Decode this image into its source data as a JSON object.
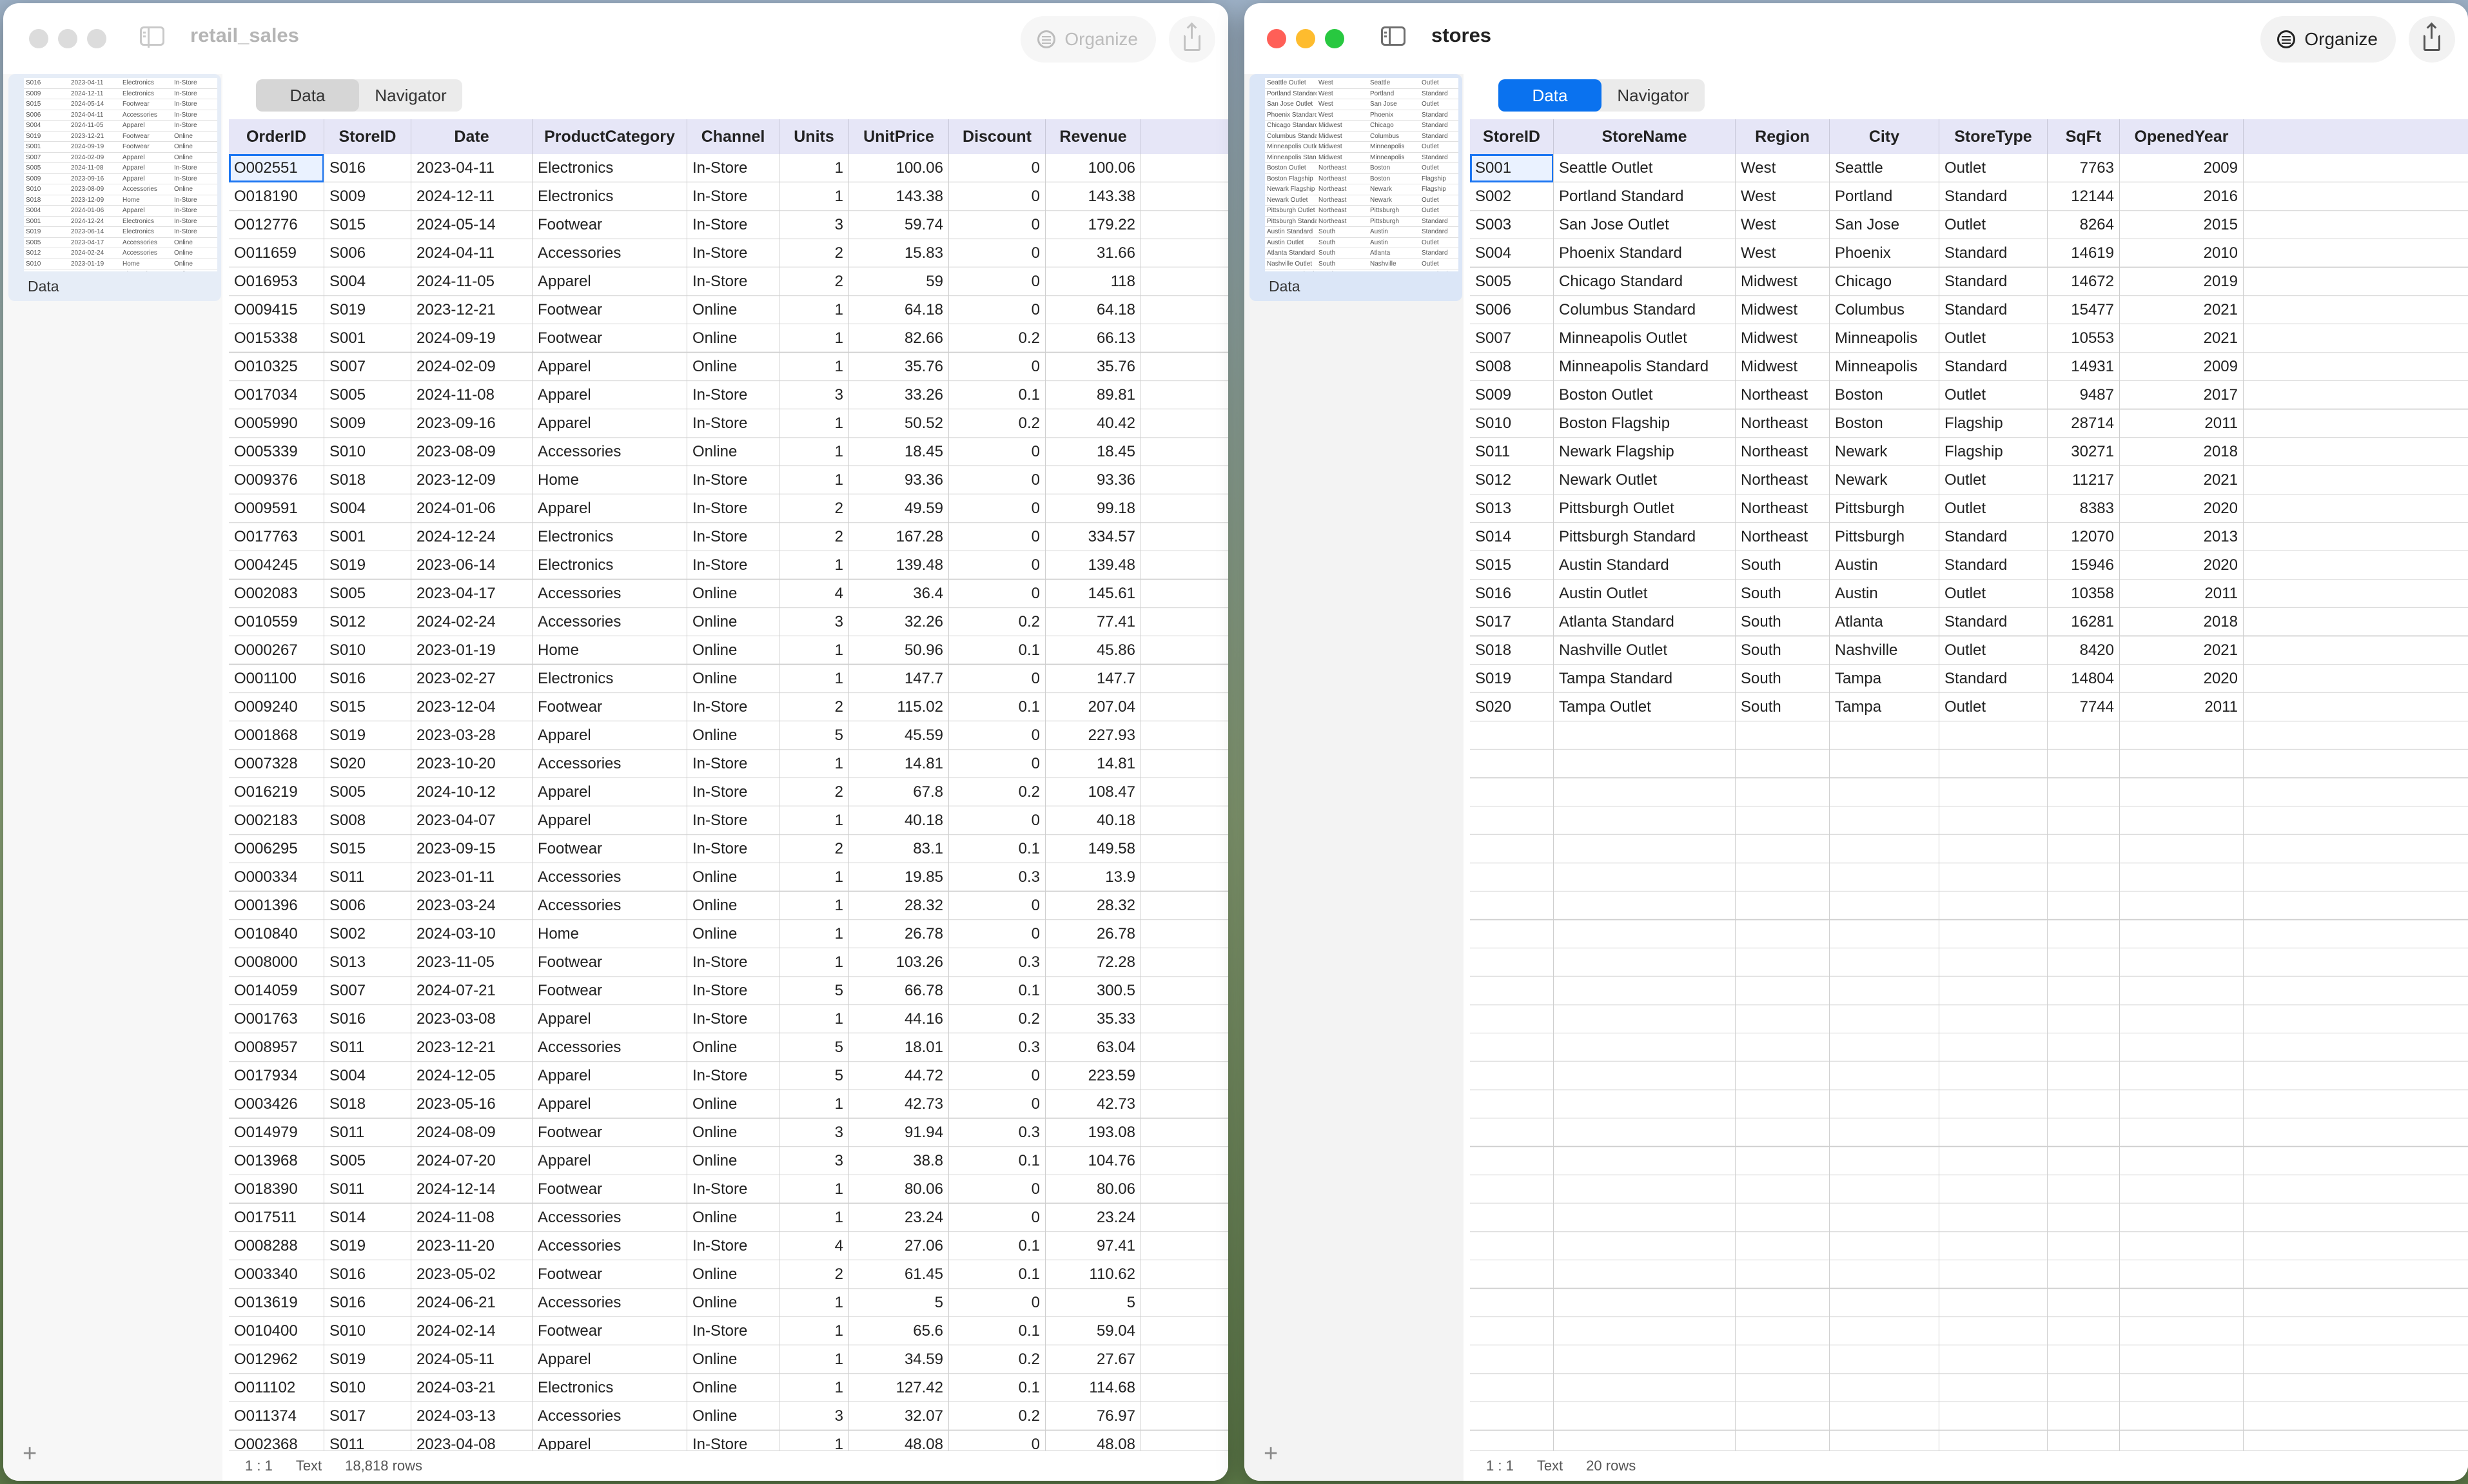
{
  "left_window": {
    "title": "retail_sales",
    "organize_label": "Organize",
    "tabs": [
      "Data",
      "Navigator"
    ],
    "sidebar_label": "Data",
    "status": {
      "position": "1 : 1",
      "type": "Text",
      "rows": "18,818 rows"
    },
    "columns": [
      "OrderID",
      "StoreID",
      "Date",
      "ProductCategory",
      "Channel",
      "Units",
      "UnitPrice",
      "Discount",
      "Revenue"
    ],
    "rows": [
      [
        "O002551",
        "S016",
        "2023-04-11",
        "Electronics",
        "In-Store",
        "1",
        "100.06",
        "0",
        "100.06"
      ],
      [
        "O018190",
        "S009",
        "2024-12-11",
        "Electronics",
        "In-Store",
        "1",
        "143.38",
        "0",
        "143.38"
      ],
      [
        "O012776",
        "S015",
        "2024-05-14",
        "Footwear",
        "In-Store",
        "3",
        "59.74",
        "0",
        "179.22"
      ],
      [
        "O011659",
        "S006",
        "2024-04-11",
        "Accessories",
        "In-Store",
        "2",
        "15.83",
        "0",
        "31.66"
      ],
      [
        "O016953",
        "S004",
        "2024-11-05",
        "Apparel",
        "In-Store",
        "2",
        "59",
        "0",
        "118"
      ],
      [
        "O009415",
        "S019",
        "2023-12-21",
        "Footwear",
        "Online",
        "1",
        "64.18",
        "0",
        "64.18"
      ],
      [
        "O015338",
        "S001",
        "2024-09-19",
        "Footwear",
        "Online",
        "1",
        "82.66",
        "0.2",
        "66.13"
      ],
      [
        "O010325",
        "S007",
        "2024-02-09",
        "Apparel",
        "Online",
        "1",
        "35.76",
        "0",
        "35.76"
      ],
      [
        "O017034",
        "S005",
        "2024-11-08",
        "Apparel",
        "In-Store",
        "3",
        "33.26",
        "0.1",
        "89.81"
      ],
      [
        "O005990",
        "S009",
        "2023-09-16",
        "Apparel",
        "In-Store",
        "1",
        "50.52",
        "0.2",
        "40.42"
      ],
      [
        "O005339",
        "S010",
        "2023-08-09",
        "Accessories",
        "Online",
        "1",
        "18.45",
        "0",
        "18.45"
      ],
      [
        "O009376",
        "S018",
        "2023-12-09",
        "Home",
        "In-Store",
        "1",
        "93.36",
        "0",
        "93.36"
      ],
      [
        "O009591",
        "S004",
        "2024-01-06",
        "Apparel",
        "In-Store",
        "2",
        "49.59",
        "0",
        "99.18"
      ],
      [
        "O017763",
        "S001",
        "2024-12-24",
        "Electronics",
        "In-Store",
        "2",
        "167.28",
        "0",
        "334.57"
      ],
      [
        "O004245",
        "S019",
        "2023-06-14",
        "Electronics",
        "In-Store",
        "1",
        "139.48",
        "0",
        "139.48"
      ],
      [
        "O002083",
        "S005",
        "2023-04-17",
        "Accessories",
        "Online",
        "4",
        "36.4",
        "0",
        "145.61"
      ],
      [
        "O010559",
        "S012",
        "2024-02-24",
        "Accessories",
        "Online",
        "3",
        "32.26",
        "0.2",
        "77.41"
      ],
      [
        "O000267",
        "S010",
        "2023-01-19",
        "Home",
        "Online",
        "1",
        "50.96",
        "0.1",
        "45.86"
      ],
      [
        "O001100",
        "S016",
        "2023-02-27",
        "Electronics",
        "Online",
        "1",
        "147.7",
        "0",
        "147.7"
      ],
      [
        "O009240",
        "S015",
        "2023-12-04",
        "Footwear",
        "In-Store",
        "2",
        "115.02",
        "0.1",
        "207.04"
      ],
      [
        "O001868",
        "S019",
        "2023-03-28",
        "Apparel",
        "Online",
        "5",
        "45.59",
        "0",
        "227.93"
      ],
      [
        "O007328",
        "S020",
        "2023-10-20",
        "Accessories",
        "In-Store",
        "1",
        "14.81",
        "0",
        "14.81"
      ],
      [
        "O016219",
        "S005",
        "2024-10-12",
        "Apparel",
        "In-Store",
        "2",
        "67.8",
        "0.2",
        "108.47"
      ],
      [
        "O002183",
        "S008",
        "2023-04-07",
        "Apparel",
        "In-Store",
        "1",
        "40.18",
        "0",
        "40.18"
      ],
      [
        "O006295",
        "S015",
        "2023-09-15",
        "Footwear",
        "In-Store",
        "2",
        "83.1",
        "0.1",
        "149.58"
      ],
      [
        "O000334",
        "S011",
        "2023-01-11",
        "Accessories",
        "Online",
        "1",
        "19.85",
        "0.3",
        "13.9"
      ],
      [
        "O001396",
        "S006",
        "2023-03-24",
        "Accessories",
        "Online",
        "1",
        "28.32",
        "0",
        "28.32"
      ],
      [
        "O010840",
        "S002",
        "2024-03-10",
        "Home",
        "Online",
        "1",
        "26.78",
        "0",
        "26.78"
      ],
      [
        "O008000",
        "S013",
        "2023-11-05",
        "Footwear",
        "In-Store",
        "1",
        "103.26",
        "0.3",
        "72.28"
      ],
      [
        "O014059",
        "S007",
        "2024-07-21",
        "Footwear",
        "In-Store",
        "5",
        "66.78",
        "0.1",
        "300.5"
      ],
      [
        "O001763",
        "S016",
        "2023-03-08",
        "Apparel",
        "In-Store",
        "1",
        "44.16",
        "0.2",
        "35.33"
      ],
      [
        "O008957",
        "S011",
        "2023-12-21",
        "Accessories",
        "Online",
        "5",
        "18.01",
        "0.3",
        "63.04"
      ],
      [
        "O017934",
        "S004",
        "2024-12-05",
        "Apparel",
        "In-Store",
        "5",
        "44.72",
        "0",
        "223.59"
      ],
      [
        "O003426",
        "S018",
        "2023-05-16",
        "Apparel",
        "Online",
        "1",
        "42.73",
        "0",
        "42.73"
      ],
      [
        "O014979",
        "S011",
        "2024-08-09",
        "Footwear",
        "Online",
        "3",
        "91.94",
        "0.3",
        "193.08"
      ],
      [
        "O013968",
        "S005",
        "2024-07-20",
        "Apparel",
        "Online",
        "3",
        "38.8",
        "0.1",
        "104.76"
      ],
      [
        "O018390",
        "S011",
        "2024-12-14",
        "Footwear",
        "In-Store",
        "1",
        "80.06",
        "0",
        "80.06"
      ],
      [
        "O017511",
        "S014",
        "2024-11-08",
        "Accessories",
        "Online",
        "1",
        "23.24",
        "0",
        "23.24"
      ],
      [
        "O008288",
        "S019",
        "2023-11-20",
        "Accessories",
        "In-Store",
        "4",
        "27.06",
        "0.1",
        "97.41"
      ],
      [
        "O003340",
        "S016",
        "2023-05-02",
        "Footwear",
        "Online",
        "2",
        "61.45",
        "0.1",
        "110.62"
      ],
      [
        "O013619",
        "S016",
        "2024-06-21",
        "Accessories",
        "Online",
        "1",
        "5",
        "0",
        "5"
      ],
      [
        "O010400",
        "S010",
        "2024-02-14",
        "Footwear",
        "In-Store",
        "1",
        "65.6",
        "0.1",
        "59.04"
      ],
      [
        "O012962",
        "S019",
        "2024-05-11",
        "Apparel",
        "Online",
        "1",
        "34.59",
        "0.2",
        "27.67"
      ],
      [
        "O011102",
        "S010",
        "2024-03-21",
        "Electronics",
        "Online",
        "1",
        "127.42",
        "0.1",
        "114.68"
      ],
      [
        "O011374",
        "S017",
        "2024-03-13",
        "Accessories",
        "Online",
        "3",
        "32.07",
        "0.2",
        "76.97"
      ],
      [
        "O002368",
        "S011",
        "2023-04-08",
        "Apparel",
        "In-Store",
        "1",
        "48.08",
        "0",
        "48.08"
      ]
    ]
  },
  "right_window": {
    "title": "stores",
    "organize_label": "Organize",
    "tabs": [
      "Data",
      "Navigator"
    ],
    "sidebar_label": "Data",
    "status": {
      "position": "1 : 1",
      "type": "Text",
      "rows": "20 rows"
    },
    "columns": [
      "StoreID",
      "StoreName",
      "Region",
      "City",
      "StoreType",
      "SqFt",
      "OpenedYear"
    ],
    "rows": [
      [
        "S001",
        "Seattle Outlet",
        "West",
        "Seattle",
        "Outlet",
        "7763",
        "2009"
      ],
      [
        "S002",
        "Portland Standard",
        "West",
        "Portland",
        "Standard",
        "12144",
        "2016"
      ],
      [
        "S003",
        "San Jose Outlet",
        "West",
        "San Jose",
        "Outlet",
        "8264",
        "2015"
      ],
      [
        "S004",
        "Phoenix Standard",
        "West",
        "Phoenix",
        "Standard",
        "14619",
        "2010"
      ],
      [
        "S005",
        "Chicago Standard",
        "Midwest",
        "Chicago",
        "Standard",
        "14672",
        "2019"
      ],
      [
        "S006",
        "Columbus Standard",
        "Midwest",
        "Columbus",
        "Standard",
        "15477",
        "2021"
      ],
      [
        "S007",
        "Minneapolis Outlet",
        "Midwest",
        "Minneapolis",
        "Outlet",
        "10553",
        "2021"
      ],
      [
        "S008",
        "Minneapolis Standard",
        "Midwest",
        "Minneapolis",
        "Standard",
        "14931",
        "2009"
      ],
      [
        "S009",
        "Boston Outlet",
        "Northeast",
        "Boston",
        "Outlet",
        "9487",
        "2017"
      ],
      [
        "S010",
        "Boston Flagship",
        "Northeast",
        "Boston",
        "Flagship",
        "28714",
        "2011"
      ],
      [
        "S011",
        "Newark Flagship",
        "Northeast",
        "Newark",
        "Flagship",
        "30271",
        "2018"
      ],
      [
        "S012",
        "Newark Outlet",
        "Northeast",
        "Newark",
        "Outlet",
        "11217",
        "2021"
      ],
      [
        "S013",
        "Pittsburgh Outlet",
        "Northeast",
        "Pittsburgh",
        "Outlet",
        "8383",
        "2020"
      ],
      [
        "S014",
        "Pittsburgh Standard",
        "Northeast",
        "Pittsburgh",
        "Standard",
        "12070",
        "2013"
      ],
      [
        "S015",
        "Austin Standard",
        "South",
        "Austin",
        "Standard",
        "15946",
        "2020"
      ],
      [
        "S016",
        "Austin Outlet",
        "South",
        "Austin",
        "Outlet",
        "10358",
        "2011"
      ],
      [
        "S017",
        "Atlanta Standard",
        "South",
        "Atlanta",
        "Standard",
        "16281",
        "2018"
      ],
      [
        "S018",
        "Nashville Outlet",
        "South",
        "Nashville",
        "Outlet",
        "8420",
        "2021"
      ],
      [
        "S019",
        "Tampa Standard",
        "South",
        "Tampa",
        "Standard",
        "14804",
        "2020"
      ],
      [
        "S020",
        "Tampa Outlet",
        "South",
        "Tampa",
        "Outlet",
        "7744",
        "2011"
      ]
    ]
  }
}
